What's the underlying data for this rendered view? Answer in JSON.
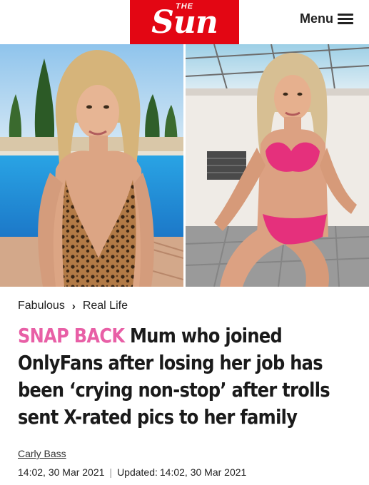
{
  "header": {
    "logo_small": "THE",
    "logo_main": "Sun",
    "menu_label": "Menu",
    "brand_color": "#e30613"
  },
  "photos": [
    {
      "icon": "photo-woman-leopard-swimsuit-pool"
    },
    {
      "icon": "photo-woman-pink-bikini-terrace"
    }
  ],
  "breadcrumb": {
    "section": "Fabulous",
    "subsection": "Real Life"
  },
  "article": {
    "kicker": "SNAP BACK",
    "headline": " Mum who joined OnlyFans after losing her job has been ‘crying non-stop’ after trolls sent X-rated pics to her family",
    "author": "Carly Bass",
    "published": "14:02, 30 Mar 2021",
    "separator": "|",
    "updated_label": "Updated:",
    "updated": "14:02, 30 Mar 2021",
    "kicker_color": "#e85fa6"
  }
}
